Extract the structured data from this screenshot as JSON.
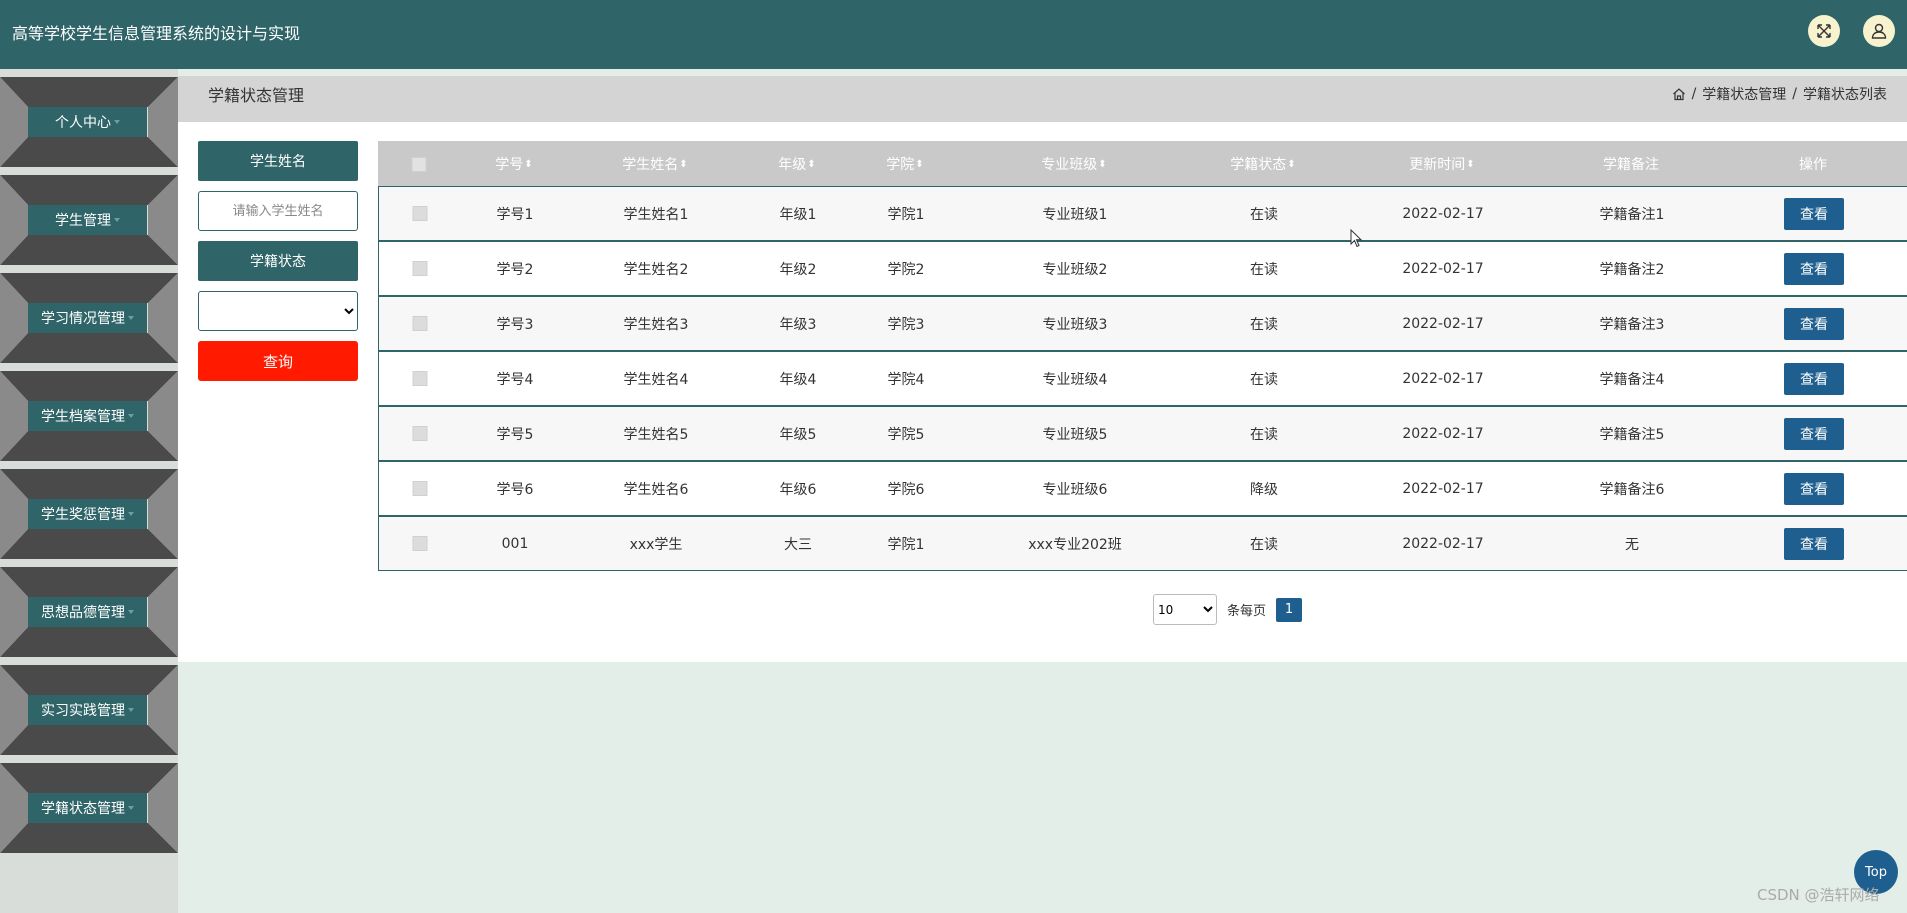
{
  "header": {
    "title": "高等学校学生信息管理系统的设计与实现",
    "fullscreen_icon": "fullscreen-icon",
    "user_icon": "user-icon",
    "colors": {
      "header_bg": "#2f6468",
      "icon_bg": "#f7f3cf"
    }
  },
  "sidebar": {
    "items": [
      {
        "label": "个人中心"
      },
      {
        "label": "学生管理"
      },
      {
        "label": "学习情况管理"
      },
      {
        "label": "学生档案管理"
      },
      {
        "label": "学生奖惩管理"
      },
      {
        "label": "思想品德管理"
      },
      {
        "label": "实习实践管理"
      },
      {
        "label": "学籍状态管理"
      }
    ]
  },
  "page": {
    "title": "学籍状态管理",
    "breadcrumb": [
      "学籍状态管理",
      "学籍状态列表"
    ],
    "breadcrumb_sep": "/"
  },
  "search": {
    "name_label": "学生姓名",
    "name_placeholder": "请输入学生姓名",
    "status_label": "学籍状态",
    "status_value": "",
    "query_label": "查询"
  },
  "table": {
    "columns": [
      "学号",
      "学生姓名",
      "年级",
      "学院",
      "专业班级",
      "学籍状态",
      "更新时间",
      "学籍备注",
      "操作"
    ],
    "rows": [
      [
        "学号1",
        "学生姓名1",
        "年级1",
        "学院1",
        "专业班级1",
        "在读",
        "2022-02-17",
        "学籍备注1"
      ],
      [
        "学号2",
        "学生姓名2",
        "年级2",
        "学院2",
        "专业班级2",
        "在读",
        "2022-02-17",
        "学籍备注2"
      ],
      [
        "学号3",
        "学生姓名3",
        "年级3",
        "学院3",
        "专业班级3",
        "在读",
        "2022-02-17",
        "学籍备注3"
      ],
      [
        "学号4",
        "学生姓名4",
        "年级4",
        "学院4",
        "专业班级4",
        "在读",
        "2022-02-17",
        "学籍备注4"
      ],
      [
        "学号5",
        "学生姓名5",
        "年级5",
        "学院5",
        "专业班级5",
        "在读",
        "2022-02-17",
        "学籍备注5"
      ],
      [
        "学号6",
        "学生姓名6",
        "年级6",
        "学院6",
        "专业班级6",
        "降级",
        "2022-02-17",
        "学籍备注6"
      ],
      [
        "001",
        "xxx学生",
        "大三",
        "学院1",
        "xxx专业202班",
        "在读",
        "2022-02-17",
        "无"
      ]
    ],
    "action_label": "查看"
  },
  "pagination": {
    "page_size": "10",
    "per_page_label": "条每页",
    "current_page": "1"
  },
  "back_to_top": "Top",
  "watermark": "CSDN @浩轩网络"
}
